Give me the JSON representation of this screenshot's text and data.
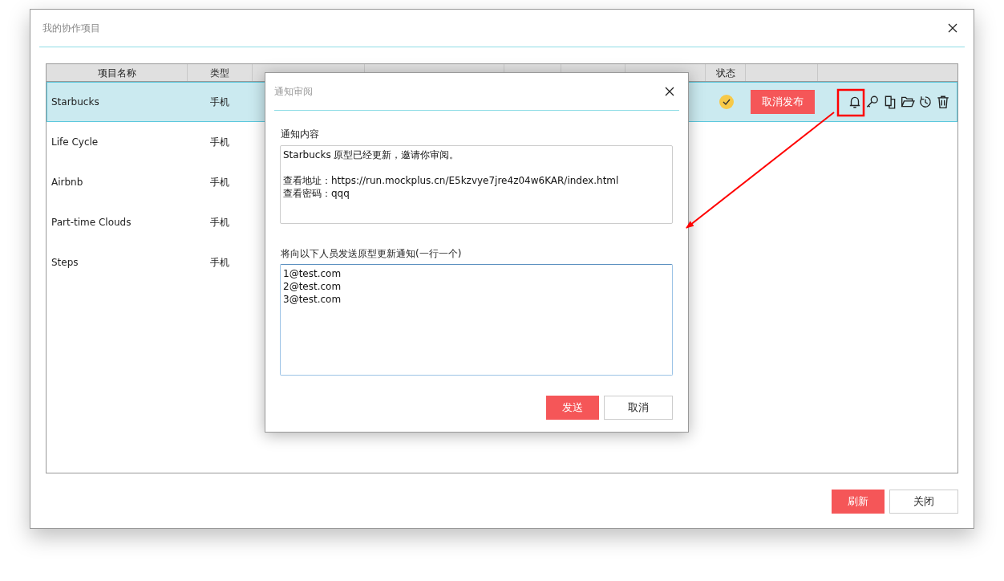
{
  "window": {
    "title": "我的协作项目"
  },
  "table": {
    "columns": [
      "项目名称",
      "类型",
      "状态"
    ],
    "rows": [
      {
        "name": "Starbucks",
        "type": "手机",
        "published": true,
        "action": "取消发布",
        "selected": true
      },
      {
        "name": "Life Cycle",
        "type": "手机",
        "published": false,
        "selected": false
      },
      {
        "name": "Airbnb",
        "type": "手机",
        "published": false,
        "selected": false
      },
      {
        "name": "Part-time Clouds",
        "type": "手机",
        "published": false,
        "selected": false
      },
      {
        "name": "Steps",
        "type": "手机",
        "published": false,
        "selected": false
      }
    ]
  },
  "dialog": {
    "title": "通知审阅",
    "content_label": "通知内容",
    "content": [
      [
        "Starbucks 原型已经更新，邀请你审阅。"
      ],
      [
        "查看地址：https://run.mockplus.cn/E5kzvye7jre4z04w6KAR/index.html",
        "查看密码：qqq"
      ]
    ],
    "recipients_label": "将向以下人员发送原型更新通知(一行一个)",
    "recipients": "1@test.com\n2@test.com\n3@test.com",
    "buttons": [
      "发送",
      "取消"
    ]
  },
  "footer": {
    "buttons": [
      "刷新",
      "关闭"
    ]
  }
}
